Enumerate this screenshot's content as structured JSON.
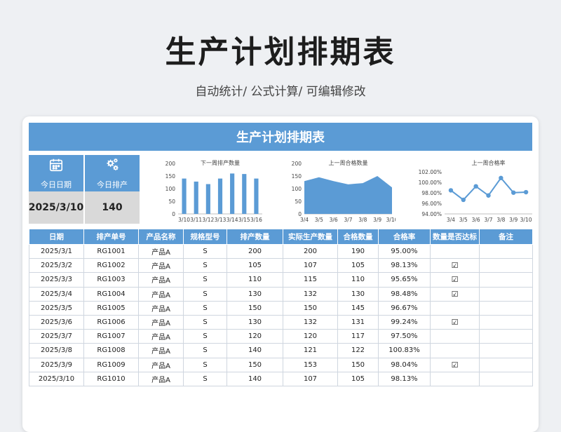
{
  "page": {
    "title": "生产计划排期表",
    "subtitle": "自动统计/ 公式计算/ 可编辑修改"
  },
  "sheet": {
    "banner": "生产计划排期表",
    "today_date": {
      "label": "今日日期",
      "value": "2025/3/10",
      "icon": "calendar-icon"
    },
    "today_schedule": {
      "label": "今日排产",
      "value": "140",
      "icon": "gears-icon"
    }
  },
  "colors": {
    "accent": "#5b9bd5",
    "stat_bg": "#d9d9d9"
  },
  "chart_data": [
    {
      "type": "bar",
      "title": "下一周排产数量",
      "categories": [
        "3/10",
        "3/11",
        "3/12",
        "3/13",
        "3/14",
        "3/15",
        "3/16"
      ],
      "values": [
        140,
        128,
        118,
        140,
        160,
        158,
        140
      ],
      "yticks": [
        "200",
        "150",
        "100",
        "50",
        "0"
      ],
      "ylim": [
        0,
        200
      ]
    },
    {
      "type": "area",
      "title": "上一周合格数量",
      "categories": [
        "3/4",
        "3/5",
        "3/6",
        "3/7",
        "3/8",
        "3/9",
        "3/10"
      ],
      "values": [
        130,
        145,
        130,
        117,
        122,
        150,
        105
      ],
      "yticks": [
        "200",
        "150",
        "100",
        "50",
        "0"
      ],
      "ylim": [
        0,
        200
      ]
    },
    {
      "type": "line",
      "title": "上一周合格率",
      "categories": [
        "3/4",
        "3/5",
        "3/6",
        "3/7",
        "3/8",
        "3/9",
        "3/10"
      ],
      "values": [
        98.48,
        96.67,
        99.24,
        97.5,
        100.83,
        98.04,
        98.13
      ],
      "yticks": [
        "102.00%",
        "100.00%",
        "98.00%",
        "96.00%",
        "94.00%"
      ],
      "ylim": [
        94,
        102
      ]
    }
  ],
  "table": {
    "headers": [
      "日期",
      "排产单号",
      "产品名称",
      "规格型号",
      "排产数量",
      "实际生产数量",
      "合格数量",
      "合格率",
      "数量是否达标",
      "备注"
    ],
    "rows": [
      [
        "2025/3/1",
        "RG1001",
        "产品A",
        "S",
        "200",
        "200",
        "190",
        "95.00%",
        "",
        ""
      ],
      [
        "2025/3/2",
        "RG1002",
        "产品A",
        "S",
        "105",
        "107",
        "105",
        "98.13%",
        "☑",
        ""
      ],
      [
        "2025/3/3",
        "RG1003",
        "产品A",
        "S",
        "110",
        "115",
        "110",
        "95.65%",
        "☑",
        ""
      ],
      [
        "2025/3/4",
        "RG1004",
        "产品A",
        "S",
        "130",
        "132",
        "130",
        "98.48%",
        "☑",
        ""
      ],
      [
        "2025/3/5",
        "RG1005",
        "产品A",
        "S",
        "150",
        "150",
        "145",
        "96.67%",
        "",
        ""
      ],
      [
        "2025/3/6",
        "RG1006",
        "产品A",
        "S",
        "130",
        "132",
        "131",
        "99.24%",
        "☑",
        ""
      ],
      [
        "2025/3/7",
        "RG1007",
        "产品A",
        "S",
        "120",
        "120",
        "117",
        "97.50%",
        "",
        ""
      ],
      [
        "2025/3/8",
        "RG1008",
        "产品A",
        "S",
        "140",
        "121",
        "122",
        "100.83%",
        "",
        ""
      ],
      [
        "2025/3/9",
        "RG1009",
        "产品A",
        "S",
        "150",
        "153",
        "150",
        "98.04%",
        "☑",
        ""
      ],
      [
        "2025/3/10",
        "RG1010",
        "产品A",
        "S",
        "140",
        "107",
        "105",
        "98.13%",
        "",
        ""
      ]
    ]
  }
}
